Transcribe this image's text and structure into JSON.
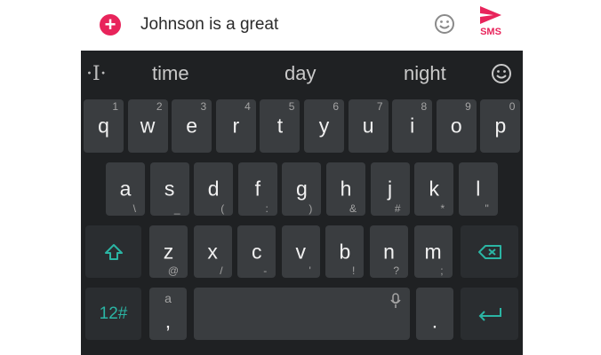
{
  "compose": {
    "add_icon": "plus-circle-icon",
    "message_text": "Johnson is a great",
    "emoji_icon": "smiley-icon",
    "send_icon": "send-arrow-icon",
    "send_label": "SMS",
    "accent_color": "#e8245b"
  },
  "suggestions": {
    "cursor_icon": "text-cursor-icon",
    "items": [
      "time",
      "day",
      "night"
    ],
    "emoji_icon": "smiley-icon"
  },
  "keyboard": {
    "row1": [
      {
        "label": "q",
        "hint": "1"
      },
      {
        "label": "w",
        "hint": "2"
      },
      {
        "label": "e",
        "hint": "3"
      },
      {
        "label": "r",
        "hint": "4"
      },
      {
        "label": "t",
        "hint": "5"
      },
      {
        "label": "y",
        "hint": "6"
      },
      {
        "label": "u",
        "hint": "7"
      },
      {
        "label": "i",
        "hint": "8"
      },
      {
        "label": "o",
        "hint": "9"
      },
      {
        "label": "p",
        "hint": "0"
      }
    ],
    "row2": [
      {
        "label": "a",
        "hint": "\\"
      },
      {
        "label": "s",
        "hint": "_"
      },
      {
        "label": "d",
        "hint": "("
      },
      {
        "label": "f",
        "hint": ":"
      },
      {
        "label": "g",
        "hint": ")"
      },
      {
        "label": "h",
        "hint": "&"
      },
      {
        "label": "j",
        "hint": "#"
      },
      {
        "label": "k",
        "hint": "*"
      },
      {
        "label": "l",
        "hint": "\""
      }
    ],
    "row3": [
      {
        "label": "z",
        "hint": "@"
      },
      {
        "label": "x",
        "hint": "/"
      },
      {
        "label": "c",
        "hint": "-"
      },
      {
        "label": "v",
        "hint": "'"
      },
      {
        "label": "b",
        "hint": "!"
      },
      {
        "label": "n",
        "hint": "?"
      },
      {
        "label": "m",
        "hint": ";"
      }
    ],
    "shift_icon": "shift-arrow-icon",
    "backspace_icon": "backspace-icon",
    "symbols_label": "12#",
    "comma_key": {
      "label": ",",
      "hint": "a"
    },
    "mic_icon": "microphone-icon",
    "period_label": ".",
    "enter_icon": "enter-arrow-icon",
    "teal_color": "#2bb5a4"
  }
}
